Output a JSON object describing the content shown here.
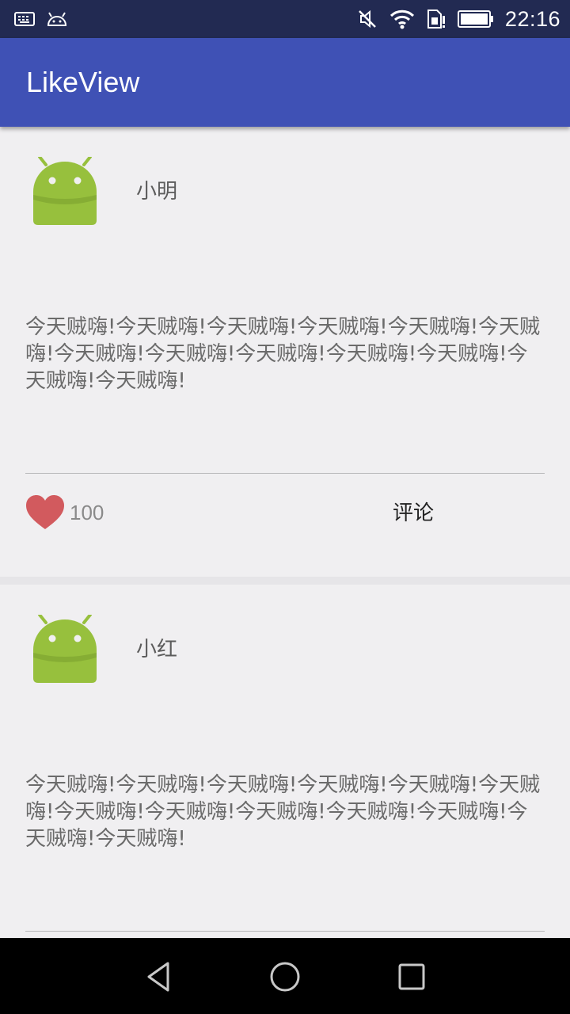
{
  "status_bar": {
    "time": "22:16",
    "left_icons": [
      "keyboard-icon",
      "android-debug-icon"
    ],
    "right_icons": [
      "mute-icon",
      "wifi-icon",
      "sim-icon",
      "battery-icon"
    ]
  },
  "app_bar": {
    "title": "LikeView",
    "color": "#3f51b5"
  },
  "posts": [
    {
      "username": "小明",
      "text": "今天贼嗨!今天贼嗨!今天贼嗨!今天贼嗨!今天贼嗨!今天贼嗨!今天贼嗨!今天贼嗨!今天贼嗨!今天贼嗨!今天贼嗨!今天贼嗨!今天贼嗨!",
      "likes": "100",
      "comment_label": "评论",
      "liked": true
    },
    {
      "username": "小红",
      "text": "今天贼嗨!今天贼嗨!今天贼嗨!今天贼嗨!今天贼嗨!今天贼嗨!今天贼嗨!今天贼嗨!今天贼嗨!今天贼嗨!今天贼嗨!今天贼嗨!今天贼嗨!"
    }
  ],
  "colors": {
    "heart": "#d25a5e",
    "android_green": "#97c03d"
  },
  "nav_bar": {
    "icons": [
      "back-icon",
      "home-icon",
      "recents-icon"
    ]
  }
}
